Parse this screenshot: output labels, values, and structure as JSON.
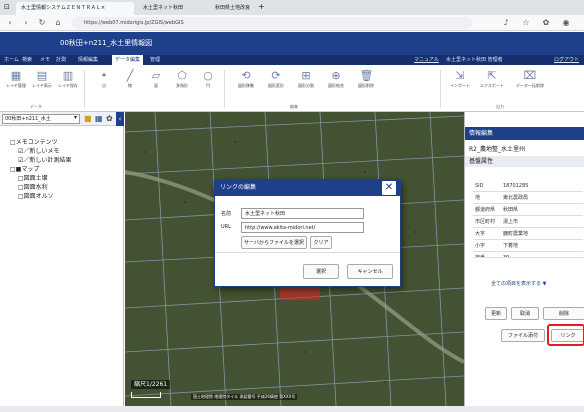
{
  "browser": {
    "tabs": [
      {
        "label": "水土里情報システムＺＥＮＴＲＡＬ×",
        "active": true
      },
      {
        "label": "水土里ネット秋田",
        "active": false
      },
      {
        "label": "秋田県土地改良",
        "active": false
      }
    ],
    "new_tab": "+",
    "url": "https://web07.midorigis.jp/ZGIS/webGIS"
  },
  "app": {
    "title": "00秋田+n211_水土里情報図",
    "menu": [
      "ホーム",
      "検索",
      "メモ",
      "計測",
      "情報編集",
      "データ編集",
      "管理"
    ],
    "selected_menu": "データ編集",
    "right_links": [
      "マニュアル",
      "水土里ネット秋田 管理者",
      "ログアウト"
    ]
  },
  "ribbon": {
    "buttons": [
      {
        "label": "レイヤ管理",
        "icon": "layer-icon"
      },
      {
        "label": "レイヤ表示",
        "icon": "layer-view-icon"
      },
      {
        "label": "レイヤ保存",
        "icon": "layer-save-icon"
      },
      {
        "label": "点",
        "icon": "point-icon"
      },
      {
        "label": "線",
        "icon": "line-icon"
      },
      {
        "label": "面",
        "icon": "polygon-icon"
      },
      {
        "label": "多角形",
        "icon": "polygon2-icon"
      },
      {
        "label": "円",
        "icon": "circle-icon"
      },
      {
        "label": "図形移動",
        "icon": "move-icon"
      },
      {
        "label": "図形変形",
        "icon": "reshape-icon"
      },
      {
        "label": "図形分割",
        "icon": "split-icon"
      },
      {
        "label": "図形結合",
        "icon": "merge-icon"
      },
      {
        "label": "図形削除",
        "icon": "delete-icon"
      },
      {
        "label": "インポート",
        "icon": "import-icon"
      },
      {
        "label": "エクスポート",
        "icon": "export-icon"
      },
      {
        "label": "データ一括削除",
        "icon": "bulk-delete-icon"
      }
    ],
    "groups": [
      "データ",
      "編集",
      "出力"
    ]
  },
  "left_panel": {
    "dataset": "00秋田+n211_水土",
    "tree": [
      {
        "label": "□メモコンテンツ",
        "indent": 0
      },
      {
        "label": "☑／新しいメモ",
        "indent": 1
      },
      {
        "label": "☑／新しい計測結果",
        "indent": 1
      },
      {
        "label": "□■マップ",
        "indent": 0
      },
      {
        "label": "□図面土壌",
        "indent": 1
      },
      {
        "label": "□図面水利",
        "indent": 1
      },
      {
        "label": "□図面オルソ",
        "indent": 1
      }
    ]
  },
  "map": {
    "scale_label": "縮尺1/2261",
    "copyright": "国土地理院 地理院タイル 承認番号 平成26情使 第XXX号"
  },
  "dialog": {
    "title": "リンクの編集",
    "name_label": "名前",
    "name_value": "水土里ネット秋田",
    "url_label": "URL",
    "url_value": "http://www.akita-midori.net/",
    "select_file_label": "サーバからファイルを選択",
    "clear_label": "クリア",
    "ok_label": "選択",
    "cancel_label": "キャンセル"
  },
  "right_panel": {
    "header": "情報編集",
    "record_title": "R2_農地整_水土里州",
    "section": "基盤属性",
    "rows": [
      {
        "key": "SID",
        "value": "18701285"
      },
      {
        "key": "地",
        "value": "東北農政局"
      },
      {
        "key": "都道府県",
        "value": "秋田県"
      },
      {
        "key": "市区町村",
        "value": "湯上市"
      },
      {
        "key": "大字",
        "value": "鹿町農業地"
      },
      {
        "key": "小字",
        "value": "下着地"
      },
      {
        "key": "地番",
        "value": "39"
      }
    ],
    "show_all": "全ての項目を表示する ▼",
    "buttons": [
      "更新",
      "取消",
      "削除"
    ],
    "file_btn": "ファイル添付",
    "link_btn": "リンク"
  },
  "colors": {
    "header_blue": "#1e3f8a",
    "menu_blue": "#16306e",
    "highlight_red": "#e02020",
    "map_bg": "#3d4b2e"
  }
}
